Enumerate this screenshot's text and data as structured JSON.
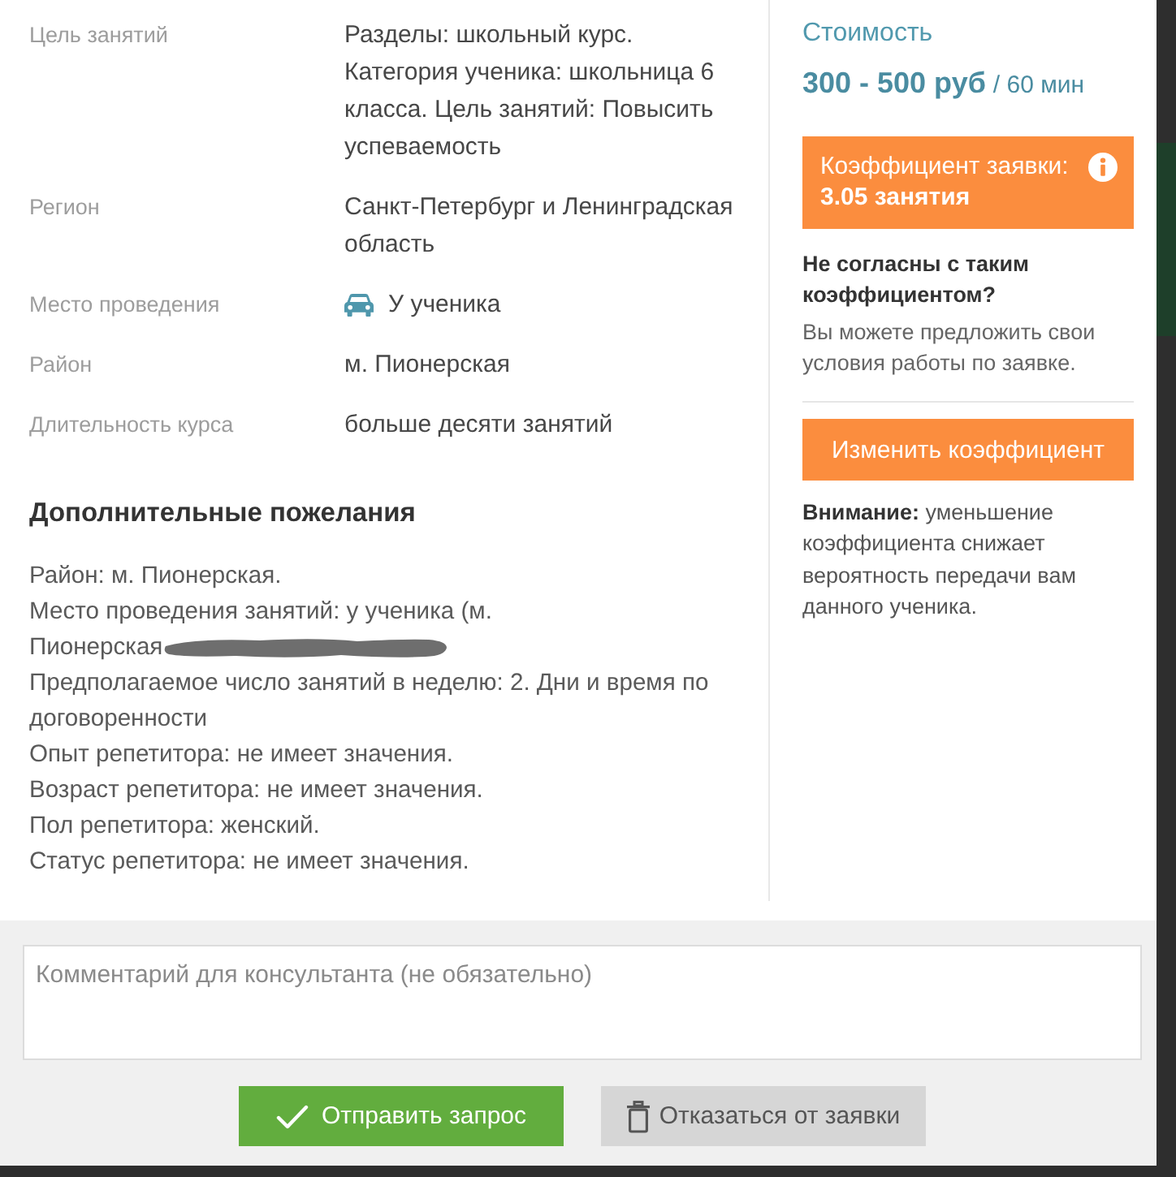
{
  "details": [
    {
      "kind": "text",
      "label": "Цель занятий",
      "value": "Разделы: школьный курс. Категория ученика: школьница 6 класса. Цель занятий: Повысить успеваемость"
    },
    {
      "kind": "text",
      "label": "Регион",
      "value": "Санкт-Петербург и Ленинградская область"
    },
    {
      "kind": "place",
      "label": "Место проведения",
      "value": "У ученика"
    },
    {
      "kind": "text",
      "label": "Район",
      "value": "м. Пионерская"
    },
    {
      "kind": "text",
      "label": "Длительность курса",
      "value": "больше десяти занятий"
    }
  ],
  "wishes": {
    "title": "Дополнительные пожелания",
    "lines": [
      {
        "text": "Район: м. Пионерская.",
        "redacted": false
      },
      {
        "text": "Место проведения занятий: у ученика (м.",
        "redacted": false
      },
      {
        "text": "Пионерская",
        "redacted": true
      },
      {
        "text": "Предполагаемое число занятий в неделю: 2. Дни и время по договоренности",
        "redacted": false
      },
      {
        "text": "Опыт репетитора: не имеет значения.",
        "redacted": false
      },
      {
        "text": "Возраст репетитора: не имеет значения.",
        "redacted": false
      },
      {
        "text": "Пол репетитора: женский.",
        "redacted": false
      },
      {
        "text": "Статус репетитора: не имеет значения.",
        "redacted": false
      }
    ]
  },
  "price": {
    "label": "Стоимость",
    "amount": "300 - 500 руб",
    "unit": "/ 60 мин"
  },
  "coefficient": {
    "label": "Коэффициент заявки:",
    "value": "3.05 занятия"
  },
  "disagree": {
    "question": "Не согласны с таким коэффициентом?",
    "hint": "Вы можете предложить свои условия работы по заявке."
  },
  "change_button": "Изменить коэффициент",
  "warning": "**Внимание:** уменьшение коэффициента снижает вероятность передачи вам данного ученика.",
  "comment": {
    "placeholder": "Комментарий для консультанта (не обязательно)"
  },
  "buttons": [
    {
      "kind": "submit",
      "label": "Отправить запрос"
    },
    {
      "kind": "decline",
      "label": "Отказаться от заявки"
    }
  ]
}
